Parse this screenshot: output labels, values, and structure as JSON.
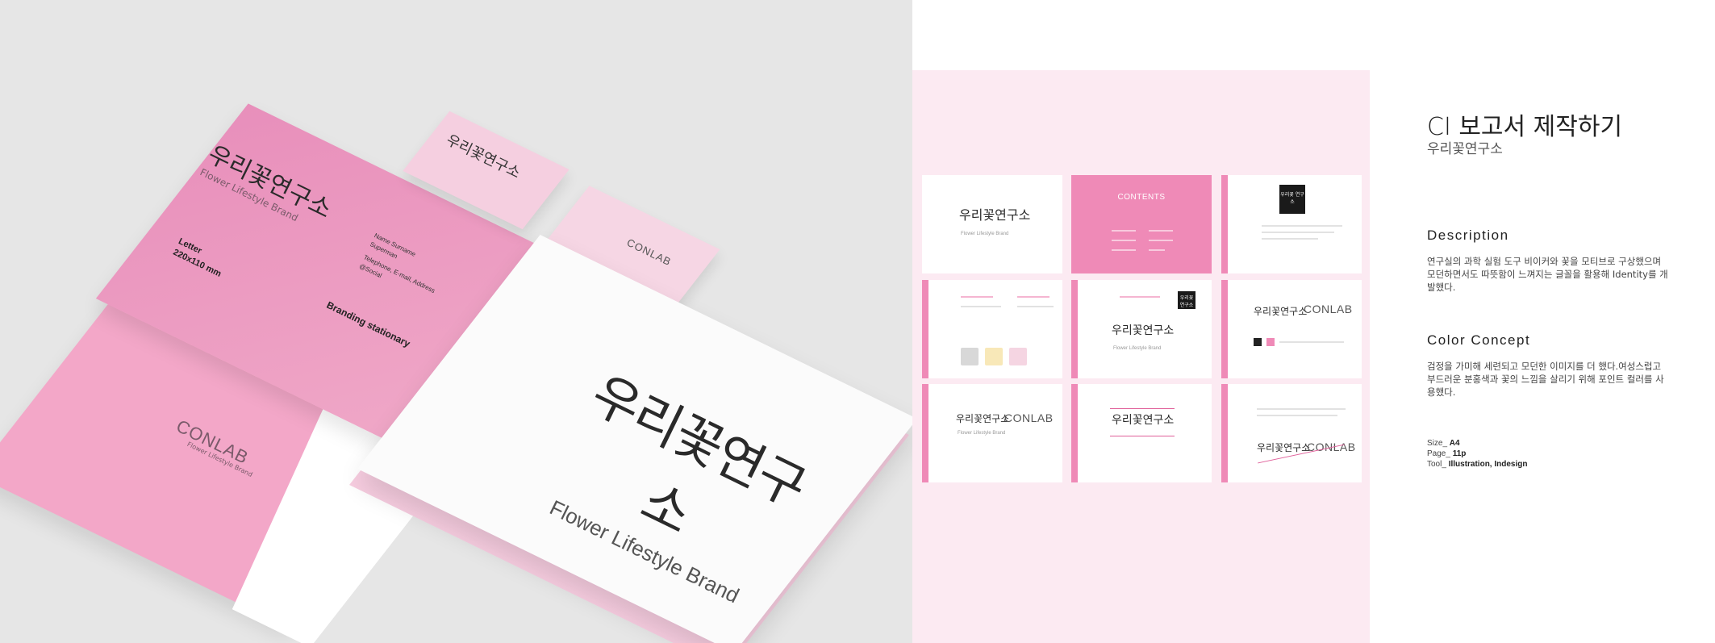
{
  "mockup": {
    "letter": {
      "logo": "우리꽃연구소",
      "logo_sub": "Flower Lifestyle Brand",
      "size_label": "Letter",
      "size_value": "220x110 mm",
      "contact_name": "Name Surname",
      "contact_role": "Superman",
      "contact_phone": "Telephone, E-mail, Address",
      "contact_social": "@Social",
      "brand": "Branding stationary"
    },
    "card1_logo": "우리꽃연구소",
    "card2_logo": "CONLAB",
    "envelope_logo": "CONLAB",
    "envelope_sub": "Flower Lifestyle Brand",
    "paper_logo": "우리꽃연구소",
    "paper_logo_sub": "Flower Lifestyle Brand"
  },
  "preview": {
    "cover_logo": "우리꽃연구소",
    "cover_sub": "Flower Lifestyle Brand",
    "contents_title": "CONTENTS",
    "black_logo": "우리꽃 연구소",
    "lab_logo": "CONLAB",
    "lab_sub": "Flower Lifestyle Brand"
  },
  "info": {
    "title": "CI 보고서 제작하기",
    "subtitle": "우리꽃연구소",
    "desc_heading": "Description",
    "desc_body": "연구실의 과학 실험 도구 비이커와 꽃을 모티브로 구상했으며 모던하면서도 따뜻함이 느껴지는 글꼴을 활용해 Identity를 개발했다.",
    "color_heading": "Color Concept",
    "color_body": "검정을 가미해 세련되고 모던한 이미지를 더 했다.여성스럽고 부드러운 분홍색과 꽃의 느낌을 살리기 위해 포인트 컬러를 사용했다.",
    "size_label": "Size_",
    "size_value": "A4",
    "page_label": "Page_",
    "page_value": "11p",
    "tool_label": "Tool_",
    "tool_value": "Illustration, Indesign"
  },
  "colors": {
    "pink": "#ef8ab7",
    "light_pink": "#fceaf2",
    "mockup_bg": "#e6e6e6"
  }
}
